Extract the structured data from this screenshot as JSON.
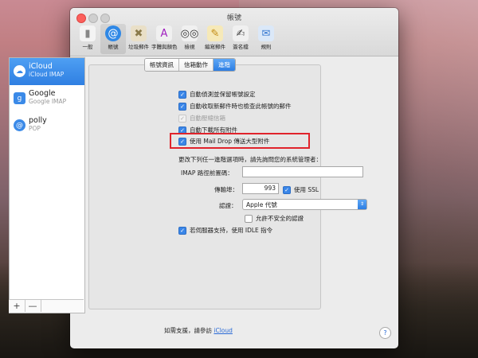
{
  "window": {
    "title": "帳號"
  },
  "toolbar": [
    {
      "label": "一般",
      "icon": "switch-icon",
      "glyph": "▮",
      "bg": "#f4f4f4",
      "fg": "#888"
    },
    {
      "label": "帳號",
      "icon": "at-sign-icon",
      "glyph": "@",
      "bg": "#2f88e6",
      "fg": "#fff"
    },
    {
      "label": "垃圾郵件",
      "icon": "junk-mail-icon",
      "glyph": "✖",
      "bg": "#e9dfc7",
      "fg": "#8a7a4a"
    },
    {
      "label": "字體與顏色",
      "icon": "font-color-icon",
      "glyph": "A",
      "bg": "#f0f0f0",
      "fg": "#a01fbf"
    },
    {
      "label": "檢視",
      "icon": "glasses-icon",
      "glyph": "◎◎",
      "bg": "#f0f0f0",
      "fg": "#333"
    },
    {
      "label": "編寫郵件",
      "icon": "compose-pencil-icon",
      "glyph": "✎",
      "bg": "#f6e9b8",
      "fg": "#c28a11"
    },
    {
      "label": "簽名檔",
      "icon": "signature-icon",
      "glyph": "✍",
      "bg": "#f0f0f0",
      "fg": "#444"
    },
    {
      "label": "規則",
      "icon": "rules-envelope-icon",
      "glyph": "✉",
      "bg": "#dbe8f8",
      "fg": "#3b7bd1"
    }
  ],
  "accounts": [
    {
      "name": "iCloud",
      "type": "iCloud IMAP",
      "icon": "cloud-icon",
      "glyph": "☁"
    },
    {
      "name": "Google",
      "type": "Google IMAP",
      "icon": "google-icon",
      "glyph": "g"
    },
    {
      "name": "polly",
      "type": "POP",
      "icon": "at-sign-icon",
      "glyph": "@"
    }
  ],
  "sidebar_footer": {
    "add": "+",
    "remove": "—"
  },
  "tabs": [
    "帳號資訊",
    "信箱動作",
    "進階"
  ],
  "options": [
    {
      "label": "自動偵測並保留帳號設定",
      "checked": true,
      "enabled": true
    },
    {
      "label": "自動收取新郵件時也檢查此帳號的郵件",
      "checked": true,
      "enabled": true
    },
    {
      "label": "自動壓縮信箱",
      "checked": true,
      "enabled": false
    },
    {
      "label": "自動下載所有附件",
      "checked": true,
      "enabled": true
    },
    {
      "label": "使用 Mail Drop 傳送大型附件",
      "checked": true,
      "enabled": true
    }
  ],
  "admin_note": "更改下列任一進階選項時，請先詢問您的系統管理者：",
  "imap_prefix": {
    "label": "IMAP 路徑前置碼：",
    "value": ""
  },
  "port": {
    "label": "傳輸埠：",
    "value": "993",
    "ssl_label": "使用 SSL",
    "ssl_checked": true
  },
  "auth": {
    "label": "認證：",
    "value": "Apple 代號"
  },
  "insecure": {
    "label": "允許不安全的認證",
    "checked": false
  },
  "idle": {
    "label": "若伺服器支持，使用 IDLE 指令",
    "checked": true
  },
  "support": {
    "text": "如需支援，請參訪",
    "link": "iCloud"
  },
  "help": "?",
  "check_mark": "✓"
}
